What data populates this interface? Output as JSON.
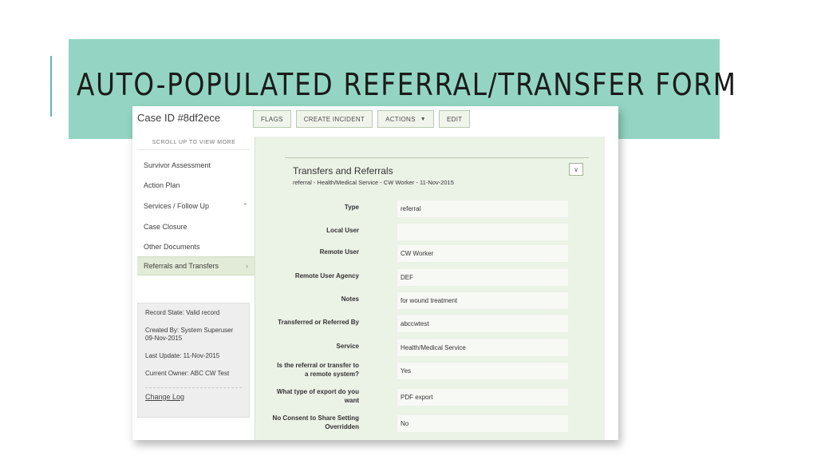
{
  "slide": {
    "title": "AUTO-POPULATED REFERRAL/TRANSFER FORM",
    "colors": {
      "band": "#93d5c2",
      "accent_line": "#5fb9b9"
    }
  },
  "header": {
    "case_id": "Case ID #8df2ece",
    "buttons": [
      {
        "label": "FLAGS"
      },
      {
        "label": "CREATE INCIDENT"
      },
      {
        "label": "ACTIONS",
        "icon": "caret-down-icon"
      },
      {
        "label": "EDIT"
      }
    ]
  },
  "sidebar": {
    "scroll_hint": "SCROLL UP TO VIEW MORE",
    "items": [
      {
        "label": "Survivor Assessment"
      },
      {
        "label": "Action Plan"
      },
      {
        "label": "Services / Follow Up",
        "icon": "chevron-up-icon"
      },
      {
        "label": "Case Closure"
      },
      {
        "label": "Other Documents"
      },
      {
        "label": "Referrals and Transfers",
        "active": true,
        "icon": "chevron-right-icon"
      }
    ],
    "record": {
      "state": "Record State: Valid record",
      "created_by": "Created By: System Superuser",
      "created_date": "09-Nov-2015",
      "last_update": "Last Update: 11-Nov-2015",
      "owner": "Current Owner: ABC CW Test",
      "change_log": "Change Log"
    }
  },
  "panel": {
    "title": "Transfers and Referrals",
    "subtitle": "referral - Health/Medical Service - CW Worker - 11-Nov-2015",
    "collapse_icon": "chevron-down-icon",
    "colors": {
      "background": "#ebf2e6",
      "field": "#f7f9f5"
    },
    "fields": [
      {
        "label": "Type",
        "value": "referral"
      },
      {
        "label": "Local User",
        "value": ""
      },
      {
        "label": "Remote User",
        "value": "CW Worker"
      },
      {
        "label": "Remote User Agency",
        "value": "DEF"
      },
      {
        "label": "Notes",
        "value": "for wound treatment"
      },
      {
        "label": "Transferred or Referred By",
        "value": "abccwtest"
      },
      {
        "label": "Service",
        "value": "Health/Medical Service"
      },
      {
        "label_line1": "Is the referral or transfer to",
        "label_line2": "a remote system?",
        "value": "Yes"
      },
      {
        "label_line1": "What type of export do you",
        "label_line2": "want",
        "value": "PDF export"
      },
      {
        "label_line1": "No Consent to Share Setting",
        "label_line2": "Overridden",
        "value": "No"
      }
    ]
  }
}
